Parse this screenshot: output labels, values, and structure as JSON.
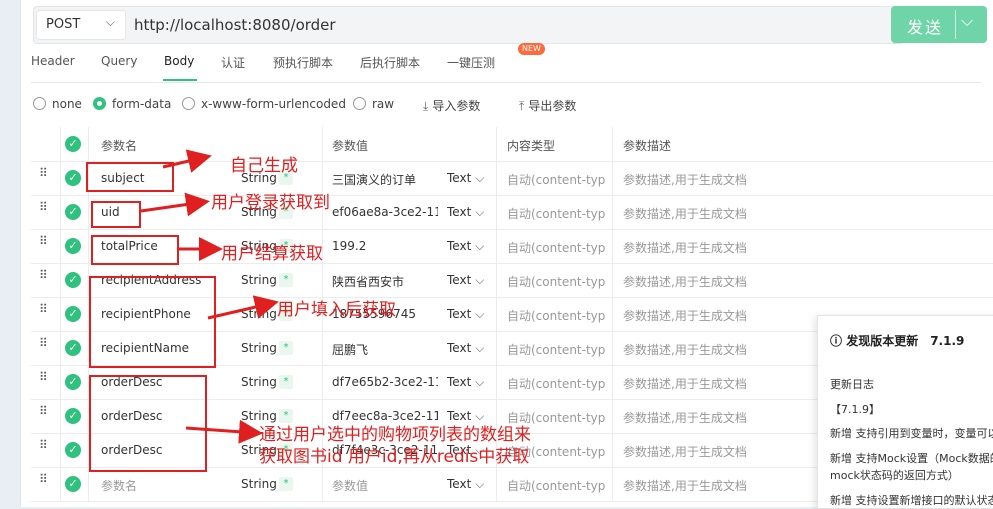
{
  "request": {
    "method": "POST",
    "url": "http://localhost:8080/order",
    "send_label": "发送"
  },
  "tabs": [
    {
      "label": "Header"
    },
    {
      "label": "Query"
    },
    {
      "label": "Body"
    },
    {
      "label": "认证"
    },
    {
      "label": "预执行脚本"
    },
    {
      "label": "后执行脚本"
    },
    {
      "label": "一键压测"
    }
  ],
  "new_badge": "NEW",
  "body_types": [
    {
      "label": "none"
    },
    {
      "label": "form-data"
    },
    {
      "label": "x-www-form-urlencoded"
    },
    {
      "label": "raw"
    }
  ],
  "actions": {
    "import": "导入参数",
    "export": "导出参数"
  },
  "table": {
    "headers": [
      "参数名",
      "参数值",
      "内容类型",
      "参数描述"
    ],
    "rows": [
      {
        "name": "subject",
        "type": "String",
        "value": "三国演义的订单",
        "ctype": "Text",
        "content_type": "自动(content-typ",
        "desc": "参数描述,用于生成文档"
      },
      {
        "name": "uid",
        "type": "String",
        "value": "ef06ae8a-3ce2-11",
        "ctype": "Text",
        "content_type": "自动(content-typ",
        "desc": "参数描述,用于生成文档"
      },
      {
        "name": "totalPrice",
        "type": "String",
        "value": "199.2",
        "ctype": "Text",
        "content_type": "自动(content-typ",
        "desc": "参数描述,用于生成文档"
      },
      {
        "name": "recipientAddress",
        "type": "String",
        "value": "陕西省西安市",
        "ctype": "Text",
        "content_type": "自动(content-typ",
        "desc": "参数描述,用于生成文档"
      },
      {
        "name": "recipientPhone",
        "type": "String",
        "value": "18755596745",
        "ctype": "Text",
        "content_type": "自动(content-typ",
        "desc": "参数描述,用于生成文档"
      },
      {
        "name": "recipientName",
        "type": "String",
        "value": "屈鹏飞",
        "ctype": "Text",
        "content_type": "自动(content-typ",
        "desc": "参数描述,用于生成文档"
      },
      {
        "name": "orderDesc",
        "type": "String",
        "value": "df7e65b2-3ce2-11",
        "ctype": "Text",
        "content_type": "自动(content-typ",
        "desc": "参数描述,用于生成文档"
      },
      {
        "name": "orderDesc",
        "type": "String",
        "value": "df7eec8a-3ce2-11",
        "ctype": "Text",
        "content_type": "自动(content-typ",
        "desc": "参数描述,用于生成文档"
      },
      {
        "name": "orderDesc",
        "type": "String",
        "value": "df7f4e3c-3ce2-11",
        "ctype": "Text",
        "content_type": "自动(content-typ",
        "desc": "参数描述,用于生成文档"
      },
      {
        "name": "参数名",
        "type": "String",
        "value": "参数值",
        "ctype": "Text",
        "content_type": "自动(content-typ",
        "desc": "参数描述,用于生成文档",
        "placeholder": true
      }
    ]
  },
  "annotations": {
    "a1": "自己生成",
    "a2": "用户登录获取到",
    "a3": "用户结算获取",
    "a4": "用户填入后获取",
    "a5_line1": "通过用户选中的购物项列表的数组来",
    "a5_line2": "获取图书id 用户id,再从redis中获取"
  },
  "popup": {
    "title": "发现版本更新",
    "version": "7.1.9",
    "lines": [
      "更新日志",
      "【7.1.9】",
      "新增 支持引用到变量时，变量可以随",
      "新增 支持Mock设置（Mock数据的",
      "mock状态码的返回方式）",
      "新增 支持设置新增接口的默认状态"
    ]
  },
  "colors": {
    "accent": "#2ec27e",
    "send": "#6fd4a8",
    "annotation": "#e02020"
  }
}
